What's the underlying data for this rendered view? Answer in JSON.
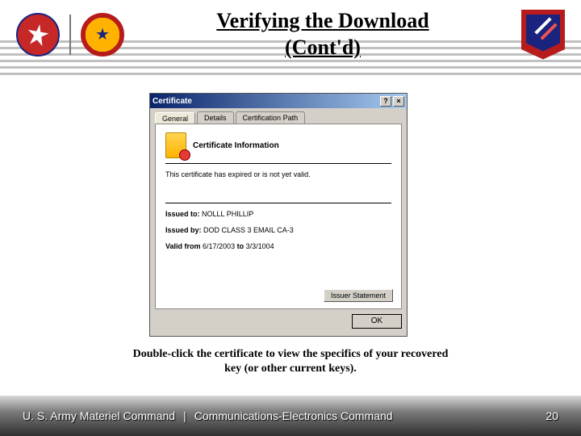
{
  "title_line1": "Verifying the Download",
  "title_line2": "(Cont'd)",
  "cert": {
    "window_title": "Certificate",
    "help_btn": "?",
    "close_btn": "×",
    "tabs": {
      "general": "General",
      "details": "Details",
      "path": "Certification Path"
    },
    "info_heading": "Certificate Information",
    "warning": "This certificate has expired or is not yet valid.",
    "issued_to_label": "Issued to:",
    "issued_to_value": "NOLLL PHILLIP",
    "issued_by_label": "Issued by:",
    "issued_by_value": "DOD CLASS 3 EMAIL CA-3",
    "valid_label": "Valid from",
    "valid_from": "6/17/2003",
    "valid_to_word": "to",
    "valid_to": "3/3/1004",
    "issuer_btn": "Issuer Statement",
    "ok": "OK"
  },
  "caption_line1": "Double-click the certificate to view the specifics of your recovered",
  "caption_line2": "key (or other current keys).",
  "footer": {
    "left": "U. S. Army Materiel Command",
    "sep": "|",
    "mid": "Communications-Electronics Command",
    "page": "20"
  }
}
